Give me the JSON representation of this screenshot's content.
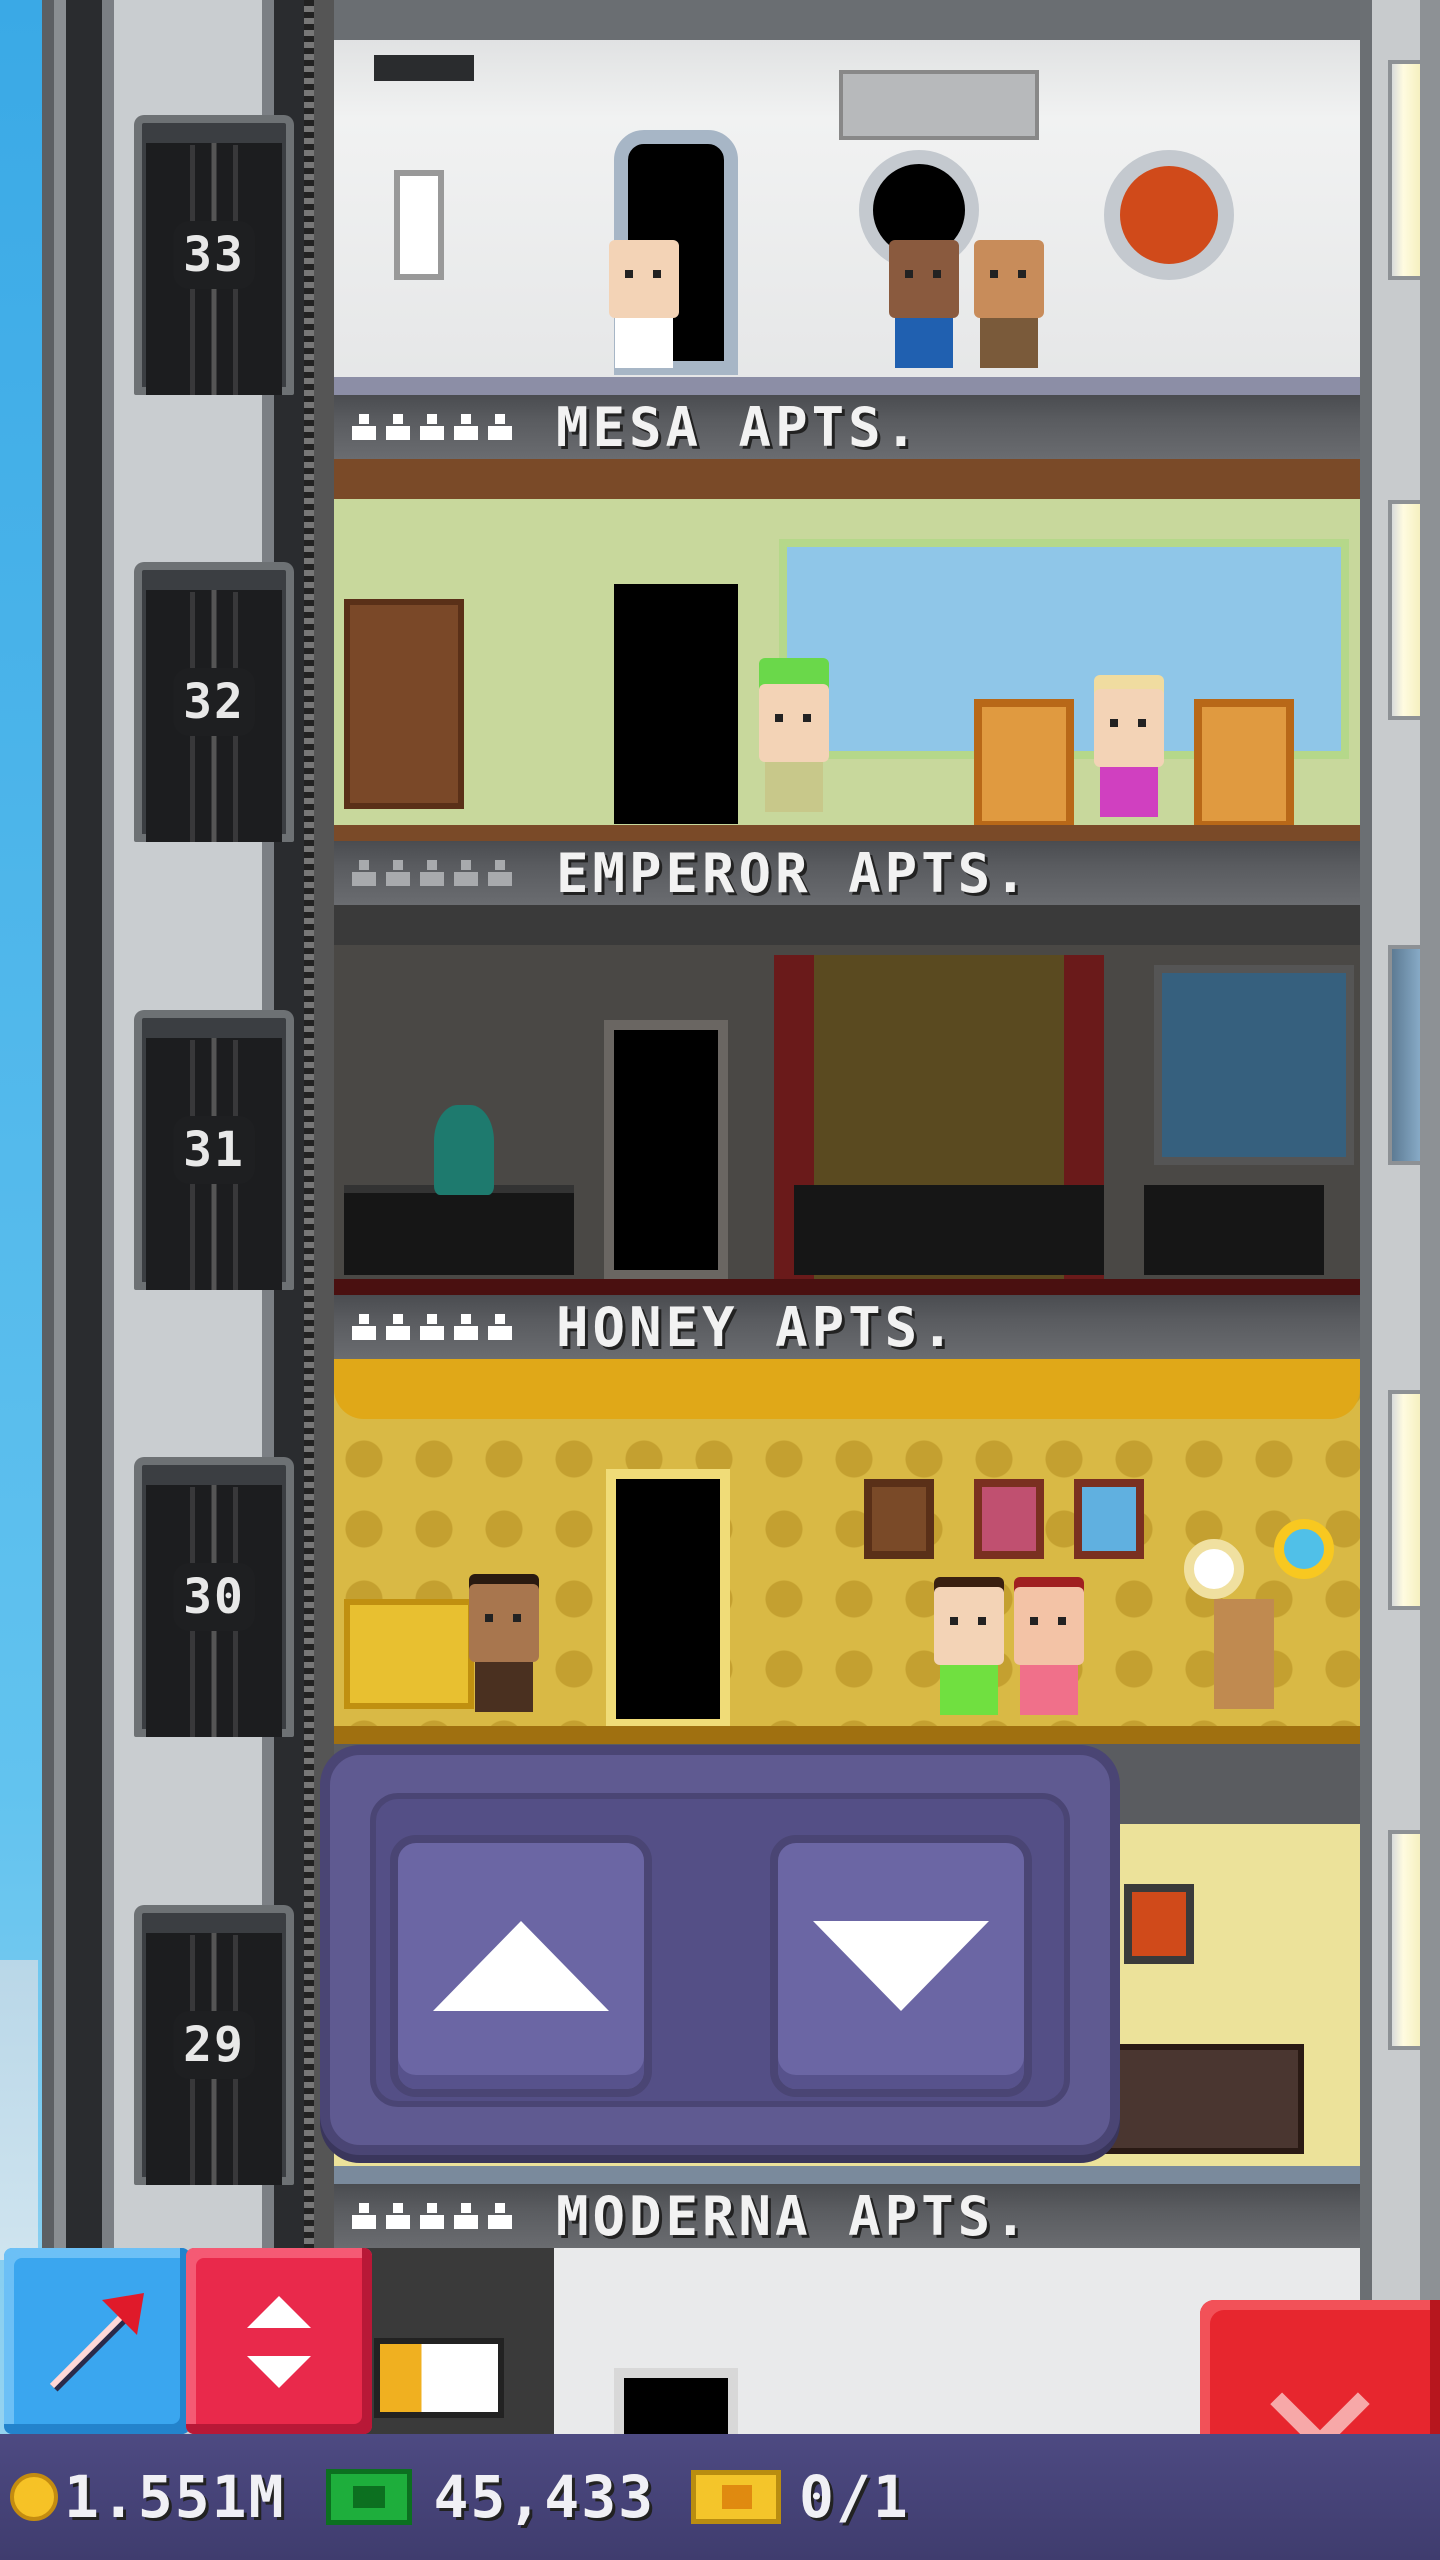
{
  "floors": [
    {
      "number": "33",
      "name": "MESA APTS.",
      "stars_filled": 5,
      "stars_total": 5
    },
    {
      "number": "32",
      "name": "EMPEROR APTS.",
      "stars_filled": 0,
      "stars_total": 5
    },
    {
      "number": "31",
      "name": "HONEY APTS.",
      "stars_filled": 5,
      "stars_total": 5
    },
    {
      "number": "30",
      "name": "",
      "stars_filled": 0,
      "stars_total": 0
    },
    {
      "number": "29",
      "name": "MODERNA APTS.",
      "stars_filled": 5,
      "stars_total": 5
    }
  ],
  "elevator_controls": {
    "up_icon": "up-arrow-icon",
    "down_icon": "down-arrow-icon"
  },
  "tools": {
    "build_icon": "pointer-arrow-icon",
    "elevator_icon": "up-down-arrows-icon",
    "close_icon": "close-x-icon"
  },
  "status": {
    "coins": "1.551M",
    "bux": "45,433",
    "tickets": "0/1"
  },
  "colors": {
    "panel": "#5f5a91",
    "build_button": "#3aa6ef",
    "elevator_button": "#e9294b",
    "close_button": "#e7262e",
    "status_bar": "#4d4a82"
  }
}
